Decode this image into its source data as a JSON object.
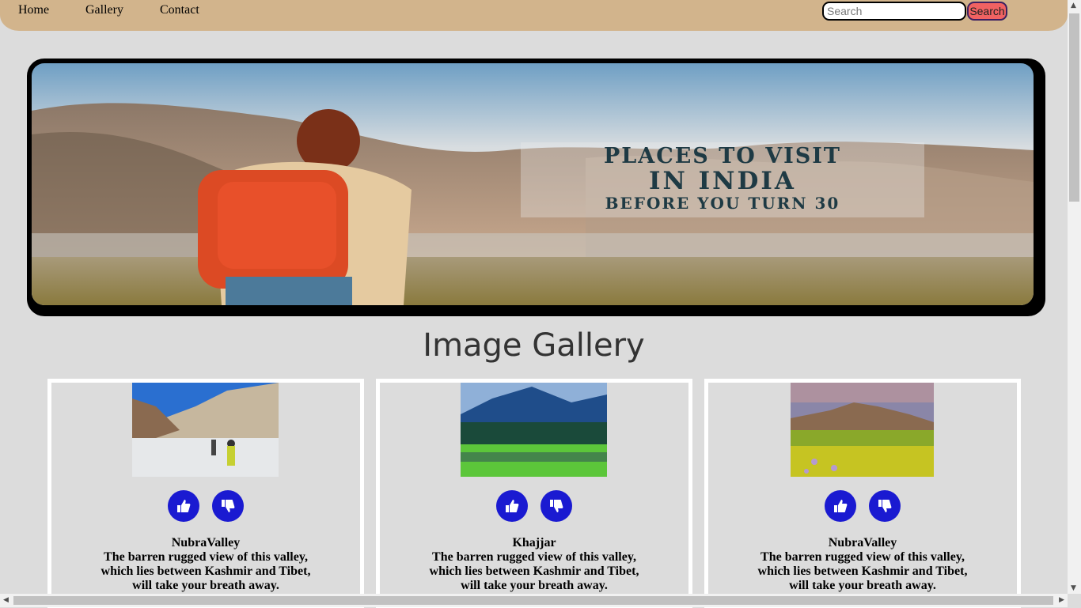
{
  "nav": {
    "items": [
      "Home",
      "Gallery",
      "Contact"
    ],
    "search_placeholder": "Search",
    "search_button": "Search"
  },
  "banner": {
    "line1": "PLACES TO VISIT",
    "line2": "IN INDIA",
    "line3": "BEFORE YOU TURN 30"
  },
  "gallery": {
    "title": "Image Gallery",
    "cards": [
      {
        "name": "NubraValley",
        "desc": [
          "The barren rugged view of this valley,",
          "which lies between Kashmir and Tibet,",
          "will take your breath away."
        ]
      },
      {
        "name": "Khajjar",
        "desc": [
          "The barren rugged view of this valley,",
          "which lies between Kashmir and Tibet,",
          "will take your breath away."
        ]
      },
      {
        "name": "NubraValley",
        "desc": [
          "The barren rugged view of this valley,",
          "which lies between Kashmir and Tibet,",
          "will take your breath away."
        ]
      }
    ]
  },
  "colors": {
    "navbar": "#d2b48c",
    "search_button": "#f06262",
    "vote_button": "#1a1ad1",
    "background": "#dcdcdc"
  },
  "icons": [
    "thumbs-up-icon",
    "thumbs-down-icon"
  ]
}
